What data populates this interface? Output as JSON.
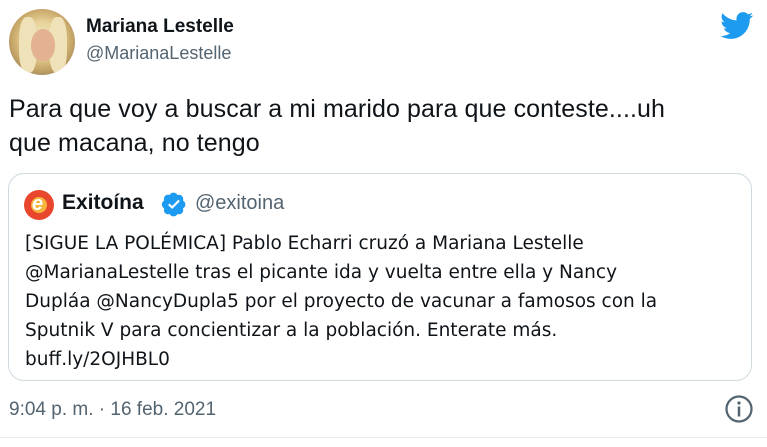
{
  "author": {
    "display_name": "Mariana Lestelle",
    "handle": "@MarianaLestelle"
  },
  "tweet": {
    "text_lines": [
      "Para que voy a buscar a mi marido para que conteste....uh",
      "que macana, no tengo"
    ],
    "timestamp": "9:04 p. m. · 16 feb. 2021"
  },
  "quoted_tweet": {
    "logo_letter": "e",
    "display_name": "Exitoína",
    "handle": "@exitoina",
    "text_lines": [
      "[SIGUE LA POLÉMICA] Pablo Echarri cruzó a Mariana Lestelle",
      "@MarianaLestelle tras el picante ida y vuelta entre ella y Nancy",
      "Dupláa @NancyDupla5 por el proyecto de vacunar a famosos con la",
      "Sputnik V para concientizar a la población. Enterate más.",
      "buff.ly/2OJHBL0"
    ]
  },
  "icons": {
    "brand": "twitter-bird-icon",
    "verified": "verified-badge-icon",
    "info": "info-icon"
  },
  "colors": {
    "brand_blue": "#1d9bf0",
    "text_primary": "#0f1419",
    "text_secondary": "#536471",
    "border": "#cfd9de",
    "logo_red": "#e8472d"
  }
}
